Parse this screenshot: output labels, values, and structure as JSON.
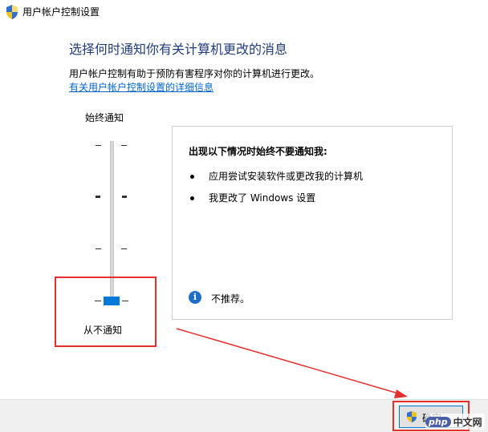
{
  "window": {
    "title": "用户帐户控制设置"
  },
  "main": {
    "heading": "选择何时通知你有关计算机更改的消息",
    "description": "用户帐户控制有助于预防有害程序对你的计算机进行更改。",
    "link": "有关用户帐户控制设置的详细信息"
  },
  "slider": {
    "top_label": "始终通知",
    "bottom_label": "从不通知",
    "levels": 4,
    "selected_level": 0
  },
  "info_box": {
    "title": "出现以下情况时始终不要通知我:",
    "bullets": [
      "应用尝试安装软件或更改我的计算机",
      "我更改了 Windows 设置"
    ],
    "note": "不推荐。"
  },
  "footer": {
    "ok_label": "确定"
  },
  "watermark": {
    "brand": "php",
    "suffix": "中文网"
  },
  "colors": {
    "accent": "#0078d7",
    "annotation": "#e53030",
    "heading": "#1f3d7a",
    "link": "#0066cc"
  }
}
